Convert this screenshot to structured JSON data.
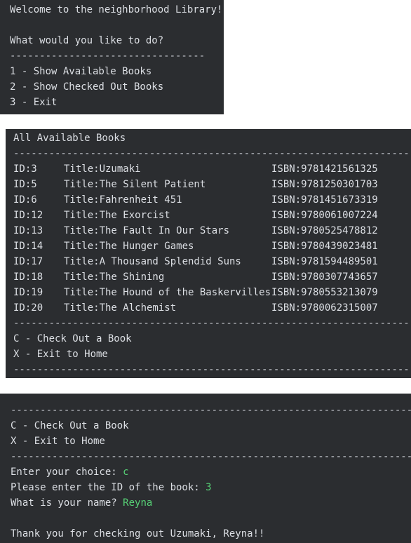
{
  "menu": {
    "welcome": "Welcome to the neighborhood Library!",
    "prompt": "What would you like to do?",
    "separator": "---------------------------------",
    "options": [
      "1 - Show Available Books",
      "2 - Show Checked Out Books",
      "3 - Exit"
    ]
  },
  "books": {
    "heading": "All Available Books",
    "separator": "----------------------------------------------------------------------",
    "rows": [
      {
        "id": "ID:3",
        "title": "Title:Uzumaki",
        "isbn": "ISBN:9781421561325"
      },
      {
        "id": "ID:5",
        "title": "Title:The Silent Patient",
        "isbn": "ISBN:9781250301703"
      },
      {
        "id": "ID:6",
        "title": "Title:Fahrenheit 451",
        "isbn": "ISBN:9781451673319"
      },
      {
        "id": "ID:12",
        "title": "Title:The Exorcist",
        "isbn": "ISBN:9780061007224"
      },
      {
        "id": "ID:13",
        "title": "Title:The Fault In Our Stars",
        "isbn": "ISBN:9780525478812"
      },
      {
        "id": "ID:14",
        "title": "Title:The Hunger Games",
        "isbn": "ISBN:9780439023481"
      },
      {
        "id": "ID:17",
        "title": "Title:A Thousand Splendid Suns",
        "isbn": "ISBN:9781594489501"
      },
      {
        "id": "ID:18",
        "title": "Title:The Shining",
        "isbn": "ISBN:9780307743657"
      },
      {
        "id": "ID:19",
        "title": "Title:The Hound of the Baskervilles",
        "isbn": "ISBN:9780553213079"
      },
      {
        "id": "ID:20",
        "title": "Title:The Alchemist",
        "isbn": "ISBN:9780062315007"
      }
    ],
    "options": [
      "C - Check Out a Book",
      "X - Exit to Home"
    ]
  },
  "checkout": {
    "separator": "----------------------------------------------------------------------",
    "options": [
      "C - Check Out a Book",
      "X - Exit to Home"
    ],
    "choice_prompt": "Enter your choice: ",
    "choice_value": "c",
    "id_prompt": "Please enter the ID of the book: ",
    "id_value": "3",
    "name_prompt": "What is your name? ",
    "name_value": "Reyna",
    "thanks": "Thank you for checking out Uzumaki, Reyna!!"
  },
  "colors": {
    "panel_bg": "#2b2d30",
    "text": "#dcdfe4",
    "user_input": "#57d276"
  }
}
